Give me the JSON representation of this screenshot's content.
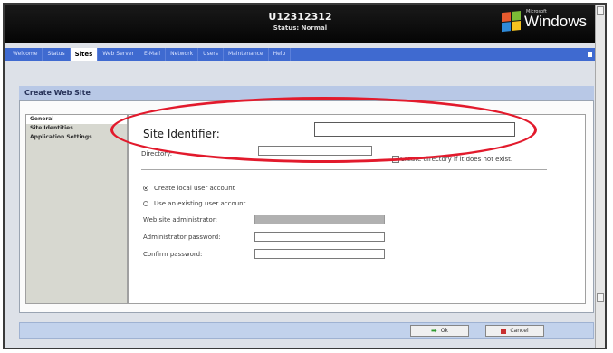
{
  "header": {
    "device_name": "U12312312",
    "device_status": "Status: Normal",
    "brand_small": "Microsoft",
    "brand": "Windows"
  },
  "nav": {
    "tabs": [
      {
        "label": "Welcome"
      },
      {
        "label": "Status"
      },
      {
        "label": "Sites",
        "active": true
      },
      {
        "label": "Web Server"
      },
      {
        "label": "E-Mail"
      },
      {
        "label": "Network"
      },
      {
        "label": "Users"
      },
      {
        "label": "Maintenance"
      },
      {
        "label": "Help"
      }
    ]
  },
  "page": {
    "title": "Create Web Site"
  },
  "sidebar": {
    "items": [
      {
        "label": "General",
        "active": true
      },
      {
        "label": "Site Identities"
      },
      {
        "label": "Application Settings"
      }
    ]
  },
  "form": {
    "site_identifier_label": "Site Identifier:",
    "site_identifier_value": "",
    "directory_label": "Directory:",
    "directory_value": "",
    "create_dir_label": "Create directory if it does not exist.",
    "create_local_user_label": "Create local user account",
    "use_existing_user_label": "Use an existing user account",
    "web_admin_label": "Web site administrator:",
    "admin_password_label": "Administrator password:",
    "confirm_password_label": "Confirm password:"
  },
  "footer": {
    "ok_label": "Ok",
    "cancel_label": "Cancel"
  },
  "colors": {
    "annotation": "#e21a2c",
    "nav": "#3f6ad0",
    "header": "#0a0a0a"
  },
  "icons": {
    "ok": "arrow-right-icon",
    "cancel": "cancel-icon",
    "logo": "windows-flag-icon"
  }
}
